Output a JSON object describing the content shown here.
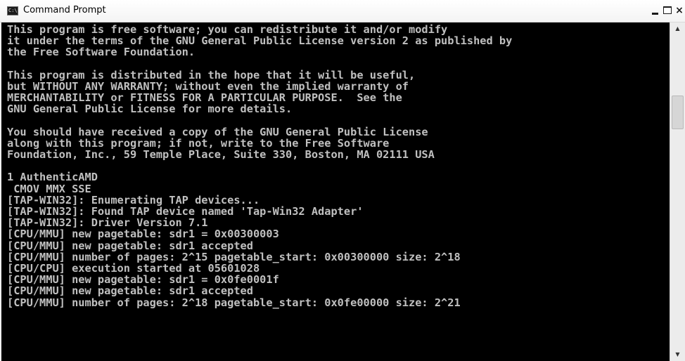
{
  "window": {
    "title": "Command Prompt",
    "icon": "cmd-icon",
    "icon_glyph": "C:\\",
    "buttons": {
      "minimize": "minimize-icon",
      "maximize": "maximize-icon",
      "close": "×"
    }
  },
  "console": {
    "background": "#000000",
    "foreground": "#c0c0c0",
    "lines": [
      "This program is free software; you can redistribute it and/or modify",
      "it under the terms of the GNU General Public License version 2 as published by",
      "the Free Software Foundation.",
      "",
      "This program is distributed in the hope that it will be useful,",
      "but WITHOUT ANY WARRANTY; without even the implied warranty of",
      "MERCHANTABILITY or FITNESS FOR A PARTICULAR PURPOSE.  See the",
      "GNU General Public License for more details.",
      "",
      "You should have received a copy of the GNU General Public License",
      "along with this program; if not, write to the Free Software",
      "Foundation, Inc., 59 Temple Place, Suite 330, Boston, MA 02111 USA",
      "",
      "1 AuthenticAMD",
      " CMOV MMX SSE",
      "[TAP-WIN32]: Enumerating TAP devices...",
      "[TAP-WIN32]: Found TAP device named 'Tap-Win32 Adapter'",
      "[TAP-WIN32]: Driver Version 7.1",
      "[CPU/MMU] new pagetable: sdr1 = 0x00300003",
      "[CPU/MMU] new pagetable: sdr1 accepted",
      "[CPU/MMU] number of pages: 2^15 pagetable_start: 0x00300000 size: 2^18",
      "[CPU/CPU] execution started at 05601028",
      "[CPU/MMU] new pagetable: sdr1 = 0x0fe0001f",
      "[CPU/MMU] new pagetable: sdr1 accepted",
      "[CPU/MMU] number of pages: 2^18 pagetable_start: 0x0fe00000 size: 2^21"
    ]
  },
  "scrollbar": {
    "up_arrow": "▲",
    "down_arrow": "▼",
    "icons": [
      "scroll-up-arrow-icon",
      "scroll-down-arrow-icon"
    ]
  }
}
